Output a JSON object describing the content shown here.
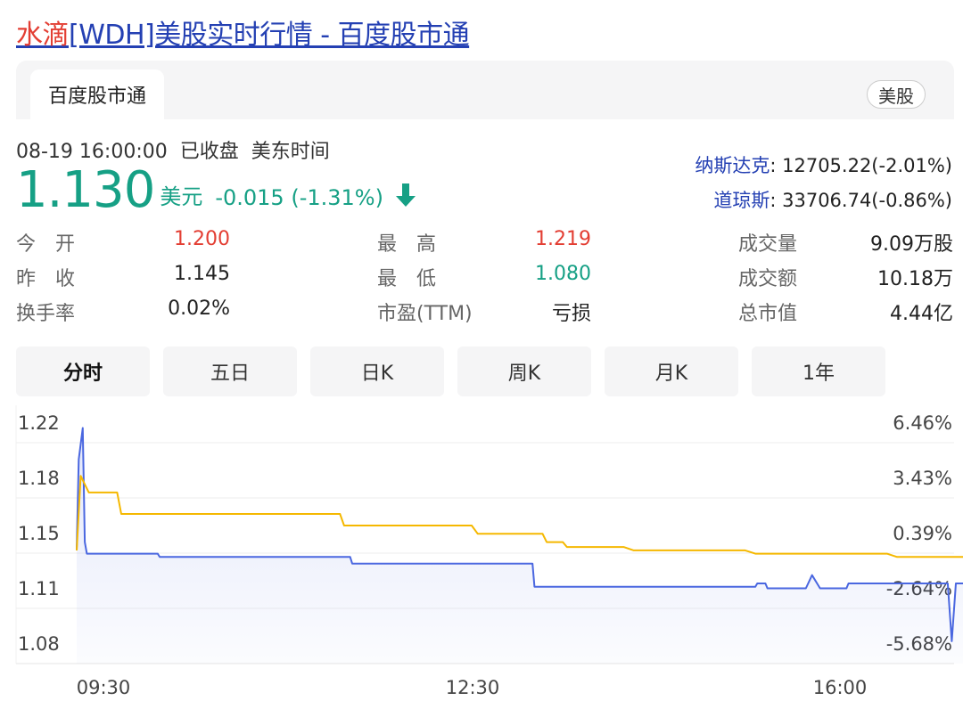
{
  "header": {
    "title_highlight": "水滴",
    "title_rest": "[WDH]美股实时行情 - 百度股市通"
  },
  "tabbar": {
    "active_tab": "百度股市通",
    "market_tag": "美股"
  },
  "quote": {
    "datetime": "08-19 16:00:00",
    "status": "已收盘",
    "timezone": "美东时间",
    "price": "1.130",
    "currency": "美元",
    "change": "-0.015 (-1.31%)",
    "direction_icon": "arrow-down-icon",
    "color_up": "#e33e33",
    "color_down": "#16a085"
  },
  "indices": [
    {
      "name": "纳斯达克",
      "value": ": 12705.22(-2.01%)"
    },
    {
      "name": "道琼斯",
      "value": ": 33706.74(-0.86%)"
    }
  ],
  "stats": {
    "open_label": "今　开",
    "open": "1.200",
    "prev_close_label": "昨　收",
    "prev_close": "1.145",
    "turnover_label": "换手率",
    "turnover": "0.02%",
    "high_label": "最　高",
    "high": "1.219",
    "low_label": "最　低",
    "low": "1.080",
    "pe_label": "市盈(TTM)",
    "pe": "亏损",
    "volume_label": "成交量",
    "volume": "9.09万股",
    "amount_label": "成交额",
    "amount": "10.18万",
    "mktcap_label": "总市值",
    "mktcap": "4.44亿"
  },
  "period_tabs": [
    "分时",
    "五日",
    "日K",
    "周K",
    "月K",
    "1年"
  ],
  "active_period": "分时",
  "chart_data": {
    "type": "line",
    "title": "",
    "xlabel": "",
    "ylabel": "",
    "x_ticks": [
      "09:30",
      "12:30",
      "16:00"
    ],
    "y_ticks": [
      "1.22",
      "1.18",
      "1.15",
      "1.11",
      "1.08"
    ],
    "y_ticks_right": [
      "6.46%",
      "3.43%",
      "0.39%",
      "-2.64%",
      "-5.68%"
    ],
    "ylim": [
      1.0765,
      1.2225
    ],
    "x_range": [
      "09:30",
      "16:00"
    ],
    "grid": true,
    "series": [
      {
        "role": "price",
        "color": "#4a67e0",
        "fill": true,
        "points": [
          [
            "09:30",
            1.145
          ],
          [
            "09:31",
            1.2
          ],
          [
            "09:33",
            1.219
          ],
          [
            "09:34",
            1.15
          ],
          [
            "09:35",
            1.143
          ],
          [
            "10:10",
            1.143
          ],
          [
            "10:11",
            1.141
          ],
          [
            "11:45",
            1.141
          ],
          [
            "11:46",
            1.137
          ],
          [
            "13:15",
            1.137
          ],
          [
            "13:16",
            1.123
          ],
          [
            "15:05",
            1.123
          ],
          [
            "15:06",
            1.125
          ],
          [
            "15:10",
            1.125
          ],
          [
            "15:11",
            1.122
          ],
          [
            "15:30",
            1.122
          ],
          [
            "15:33",
            1.13
          ],
          [
            "15:37",
            1.122
          ],
          [
            "15:50",
            1.122
          ],
          [
            "15:51",
            1.125
          ],
          [
            "16:40",
            1.125
          ],
          [
            "16:42",
            1.09
          ],
          [
            "16:44",
            1.125
          ],
          [
            "17:01",
            1.125
          ],
          [
            "17:03",
            1.103
          ],
          [
            "17:05",
            1.107
          ],
          [
            "17:08",
            1.103
          ],
          [
            "17:14",
            1.106
          ],
          [
            "17:18",
            1.101
          ],
          [
            "17:30",
            1.101
          ],
          [
            "17:35",
            1.09
          ],
          [
            "17:55",
            1.09
          ],
          [
            "18:00",
            1.088
          ],
          [
            "20:15",
            1.088
          ],
          [
            "20:20",
            1.079
          ],
          [
            "20:38",
            1.079
          ],
          [
            "20:45",
            1.077
          ],
          [
            "21:18",
            1.077
          ],
          [
            "21:23",
            1.081
          ],
          [
            "21:29",
            1.081
          ],
          [
            "21:34",
            1.086
          ],
          [
            "21:55",
            1.086
          ],
          [
            "21:58",
            1.08
          ],
          [
            "22:05",
            1.08
          ],
          [
            "22:08",
            1.086
          ],
          [
            "22:10",
            1.086
          ],
          [
            "22:13",
            1.107
          ],
          [
            "22:17",
            1.13
          ]
        ]
      },
      {
        "role": "average",
        "color": "#f5b800",
        "fill": false,
        "points": [
          [
            "09:30",
            1.145
          ],
          [
            "09:32",
            1.19
          ],
          [
            "09:36",
            1.18
          ],
          [
            "09:50",
            1.18
          ],
          [
            "09:52",
            1.167
          ],
          [
            "11:40",
            1.167
          ],
          [
            "11:42",
            1.16
          ],
          [
            "12:45",
            1.16
          ],
          [
            "12:48",
            1.155
          ],
          [
            "13:20",
            1.155
          ],
          [
            "13:22",
            1.15
          ],
          [
            "13:30",
            1.15
          ],
          [
            "13:32",
            1.147
          ],
          [
            "14:00",
            1.147
          ],
          [
            "14:05",
            1.145
          ],
          [
            "15:00",
            1.145
          ],
          [
            "15:05",
            1.143
          ],
          [
            "16:10",
            1.143
          ],
          [
            "16:15",
            1.141
          ],
          [
            "17:40",
            1.141
          ],
          [
            "17:45",
            1.14
          ],
          [
            "19:40",
            1.14
          ],
          [
            "19:45",
            1.138
          ],
          [
            "20:00",
            1.138
          ],
          [
            "20:05",
            1.132
          ],
          [
            "21:30",
            1.132
          ],
          [
            "21:35",
            1.13
          ],
          [
            "22:17",
            1.13
          ]
        ]
      }
    ]
  }
}
